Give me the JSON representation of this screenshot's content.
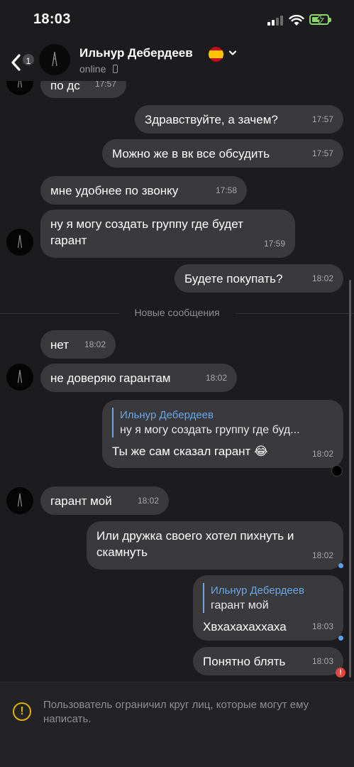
{
  "status_bar": {
    "time": "18:03",
    "signal_bars": 2,
    "signal_max": 4
  },
  "header": {
    "back_badge": "1",
    "contact_name": "Ильнур Дебердеев",
    "status": "online",
    "flag_icon": "spain-flag-icon"
  },
  "messages": [
    {
      "id": "m0",
      "side": "in",
      "text": "по дс",
      "time": "17:57"
    },
    {
      "id": "m1",
      "side": "out",
      "text": "Здравствуйте, а зачем?",
      "time": "17:57"
    },
    {
      "id": "m2",
      "side": "out",
      "text": "Можно же в вк все обсудить",
      "time": "17:57"
    },
    {
      "id": "m3",
      "side": "in",
      "text": "мне удобнее по звонку",
      "time": "17:58"
    },
    {
      "id": "m4",
      "side": "in",
      "text": "ну я могу создать группу где будет гарант",
      "time": "17:59"
    },
    {
      "id": "m5",
      "side": "out",
      "text": "Будете покупать?",
      "time": "18:02"
    },
    {
      "id": "m6",
      "side": "in",
      "text": "нет",
      "time": "18:02"
    },
    {
      "id": "m7",
      "side": "in",
      "text": "не доверяю гарантам",
      "time": "18:02"
    },
    {
      "id": "m8",
      "side": "out",
      "reply_name": "Ильнур Дебердеев",
      "reply_text": "ну я могу создать группу где буд...",
      "text": "Ты же сам сказал гарант 😂",
      "time": "18:02"
    },
    {
      "id": "m9",
      "side": "in",
      "text": "гарант мой",
      "time": "18:02"
    },
    {
      "id": "m10",
      "side": "out",
      "text": "Или дружка своего хотел пихнуть и скамнуть",
      "time": "18:02"
    },
    {
      "id": "m11",
      "side": "out",
      "reply_name": "Ильнур Дебердеев",
      "reply_text": "гарант мой",
      "text": "Хвхахахаххаха",
      "time": "18:03"
    },
    {
      "id": "m12",
      "side": "out",
      "text": "Понятно блять",
      "time": "18:03",
      "error": "!"
    }
  ],
  "new_messages_divider": "Новые сообщения",
  "notice": {
    "text": "Пользователь ограничил круг лиц, которые могут ему написать."
  },
  "colors": {
    "background": "#1c1c1e",
    "bubble": "#3a3a3c",
    "link": "#6aa7e8",
    "error": "#e5453f",
    "warning": "#e0b000",
    "battery": "#8bd46c"
  }
}
